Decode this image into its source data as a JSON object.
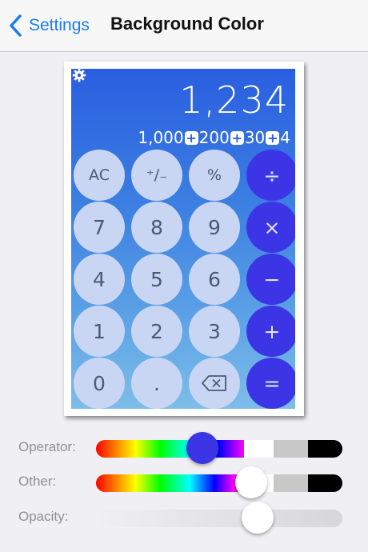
{
  "nav": {
    "back_label": "Settings",
    "title": "Background Color",
    "accent_color": "#1a7cf6"
  },
  "calculator": {
    "display": "1,234",
    "expression": [
      "1,000",
      "+",
      "200",
      "+",
      "30",
      "+",
      "4"
    ],
    "settings_icon": "gear-icon",
    "keys": {
      "ac": "AC",
      "sign": "⁺∕₋",
      "percent": "%",
      "divide": "÷",
      "seven": "7",
      "eight": "8",
      "nine": "9",
      "multiply": "×",
      "four": "4",
      "five": "5",
      "six": "6",
      "minus": "−",
      "one": "1",
      "two": "2",
      "three": "3",
      "plus": "+",
      "zero": "0",
      "dot": ".",
      "backspace_icon": "backspace-icon",
      "equals": "="
    },
    "colors": {
      "operator_key": "#3c35e6",
      "other_key": "#c9d6f3",
      "background_top": "#2a5ee0",
      "background_bottom": "#7ebde9"
    }
  },
  "sliders": {
    "operator": {
      "label": "Operator:",
      "value": 0.42
    },
    "other": {
      "label": "Other:",
      "value": 0.65
    },
    "opacity": {
      "label": "Opacity:",
      "value": 0.68
    }
  }
}
